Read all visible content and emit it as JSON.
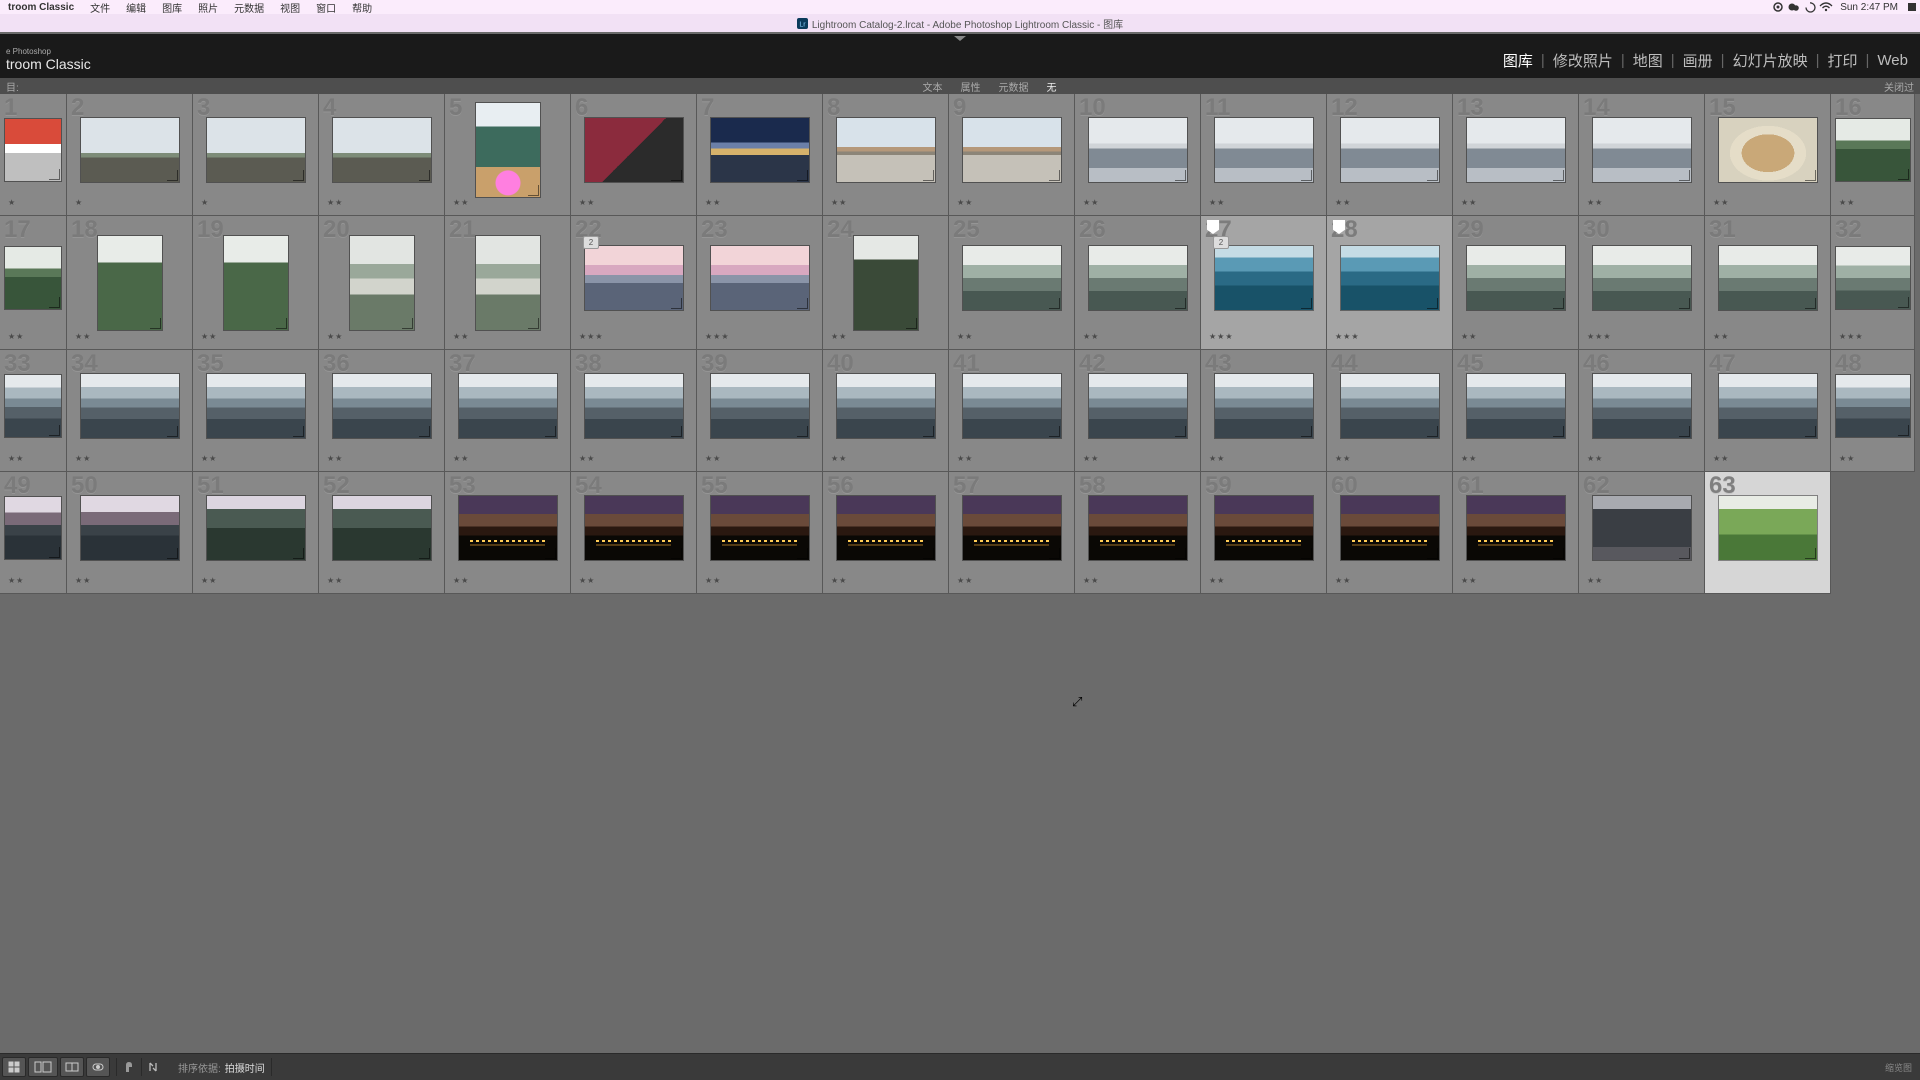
{
  "mac_menu": {
    "app": "troom Classic",
    "items": [
      "文件",
      "编辑",
      "图库",
      "照片",
      "元数据",
      "视图",
      "窗口",
      "帮助"
    ],
    "clock": "Sun 2:47 PM"
  },
  "window_title": "Lightroom Catalog-2.lrcat - Adobe Photoshop Lightroom Classic - 图库",
  "logo": {
    "small": "e Photoshop",
    "big": "troom Classic"
  },
  "modules": [
    "图库",
    "修改照片",
    "地图",
    "画册",
    "幻灯片放映",
    "打印",
    "Web"
  ],
  "modules_active": 0,
  "info_bar": {
    "left": "目:",
    "options": [
      "文本",
      "属性",
      "元数据",
      "无"
    ],
    "active": 3,
    "right": "关闭过"
  },
  "toolbar": {
    "sort_label": "排序依据:",
    "sort_value": "拍摄时间",
    "right": "缩览图"
  },
  "thumbs": [
    {
      "n": 1,
      "s": 1,
      "o": "l",
      "t": "t-red",
      "first": true
    },
    {
      "n": 2,
      "s": 1,
      "o": "l",
      "t": "t-road"
    },
    {
      "n": 3,
      "s": 1,
      "o": "l",
      "t": "t-road"
    },
    {
      "n": 4,
      "s": 2,
      "o": "l",
      "t": "t-road"
    },
    {
      "n": 5,
      "s": 2,
      "o": "p",
      "t": "t-temple1"
    },
    {
      "n": 6,
      "s": 2,
      "o": "l",
      "t": "t-temple2"
    },
    {
      "n": 7,
      "s": 2,
      "o": "l",
      "t": "t-temple3"
    },
    {
      "n": 8,
      "s": 2,
      "o": "l",
      "t": "t-gate"
    },
    {
      "n": 9,
      "s": 2,
      "o": "l",
      "t": "t-gate"
    },
    {
      "n": 10,
      "s": 2,
      "o": "l",
      "t": "t-group"
    },
    {
      "n": 11,
      "s": 2,
      "o": "l",
      "t": "t-group"
    },
    {
      "n": 12,
      "s": 2,
      "o": "l",
      "t": "t-group"
    },
    {
      "n": 13,
      "s": 2,
      "o": "l",
      "t": "t-group"
    },
    {
      "n": 14,
      "s": 2,
      "o": "l",
      "t": "t-group"
    },
    {
      "n": 15,
      "s": 2,
      "o": "l",
      "t": "t-dog"
    },
    {
      "n": 16,
      "s": 2,
      "o": "l",
      "t": "t-green",
      "last": true
    },
    {
      "n": 17,
      "s": 2,
      "o": "l",
      "t": "t-green",
      "first": true,
      "tall": true
    },
    {
      "n": 18,
      "s": 2,
      "o": "p",
      "t": "t-treegreen",
      "tall": true
    },
    {
      "n": 19,
      "s": 2,
      "o": "p",
      "t": "t-treegreen",
      "tall": true
    },
    {
      "n": 20,
      "s": 2,
      "o": "p",
      "t": "t-path",
      "tall": true
    },
    {
      "n": 21,
      "s": 2,
      "o": "p",
      "t": "t-path",
      "tall": true
    },
    {
      "n": 22,
      "s": 3,
      "o": "l",
      "t": "t-sunset",
      "tall": true,
      "stack": 2
    },
    {
      "n": 23,
      "s": 3,
      "o": "l",
      "t": "t-sunset",
      "tall": true
    },
    {
      "n": 24,
      "s": 2,
      "o": "p",
      "t": "t-tree-dark",
      "tall": true
    },
    {
      "n": 25,
      "s": 2,
      "o": "l",
      "t": "t-haze",
      "tall": true
    },
    {
      "n": 26,
      "s": 2,
      "o": "l",
      "t": "t-haze",
      "tall": true
    },
    {
      "n": 27,
      "s": 3,
      "o": "l",
      "t": "t-bluemt",
      "tall": true,
      "pick": true,
      "stack": 2,
      "picked": true
    },
    {
      "n": 28,
      "s": 3,
      "o": "l",
      "t": "t-bluemt",
      "tall": true,
      "pick": true,
      "picked": true
    },
    {
      "n": 29,
      "s": 2,
      "o": "l",
      "t": "t-haze",
      "tall": true
    },
    {
      "n": 30,
      "s": 3,
      "o": "l",
      "t": "t-haze",
      "tall": true
    },
    {
      "n": 31,
      "s": 2,
      "o": "l",
      "t": "t-haze",
      "tall": true
    },
    {
      "n": 32,
      "s": 3,
      "o": "l",
      "t": "t-haze",
      "last": true,
      "tall": true
    },
    {
      "n": 33,
      "s": 2,
      "o": "l",
      "t": "t-mtlayer",
      "first": true
    },
    {
      "n": 34,
      "s": 2,
      "o": "l",
      "t": "t-mtlayer"
    },
    {
      "n": 35,
      "s": 2,
      "o": "l",
      "t": "t-mtlayer"
    },
    {
      "n": 36,
      "s": 2,
      "o": "l",
      "t": "t-mtlayer"
    },
    {
      "n": 37,
      "s": 2,
      "o": "l",
      "t": "t-mtlayer"
    },
    {
      "n": 38,
      "s": 2,
      "o": "l",
      "t": "t-mtlayer"
    },
    {
      "n": 39,
      "s": 2,
      "o": "l",
      "t": "t-mtlayer"
    },
    {
      "n": 40,
      "s": 2,
      "o": "l",
      "t": "t-mtlayer"
    },
    {
      "n": 41,
      "s": 2,
      "o": "l",
      "t": "t-mtlayer"
    },
    {
      "n": 42,
      "s": 2,
      "o": "l",
      "t": "t-mtlayer"
    },
    {
      "n": 43,
      "s": 2,
      "o": "l",
      "t": "t-mtlayer"
    },
    {
      "n": 44,
      "s": 2,
      "o": "l",
      "t": "t-mtlayer"
    },
    {
      "n": 45,
      "s": 2,
      "o": "l",
      "t": "t-mtlayer"
    },
    {
      "n": 46,
      "s": 2,
      "o": "l",
      "t": "t-mtlayer"
    },
    {
      "n": 47,
      "s": 2,
      "o": "l",
      "t": "t-mtlayer"
    },
    {
      "n": 48,
      "s": 2,
      "o": "l",
      "t": "t-mtlayer",
      "last": true
    },
    {
      "n": 49,
      "s": 2,
      "o": "l",
      "t": "t-dusk",
      "first": true
    },
    {
      "n": 50,
      "s": 2,
      "o": "l",
      "t": "t-dusk"
    },
    {
      "n": 51,
      "s": 2,
      "o": "l",
      "t": "t-dusktree"
    },
    {
      "n": 52,
      "s": 2,
      "o": "l",
      "t": "t-dusktree"
    },
    {
      "n": 53,
      "s": 2,
      "o": "l",
      "t": "t-night"
    },
    {
      "n": 54,
      "s": 2,
      "o": "l",
      "t": "t-night"
    },
    {
      "n": 55,
      "s": 2,
      "o": "l",
      "t": "t-night"
    },
    {
      "n": 56,
      "s": 2,
      "o": "l",
      "t": "t-night"
    },
    {
      "n": 57,
      "s": 2,
      "o": "l",
      "t": "t-night"
    },
    {
      "n": 58,
      "s": 2,
      "o": "l",
      "t": "t-night"
    },
    {
      "n": 59,
      "s": 2,
      "o": "l",
      "t": "t-night"
    },
    {
      "n": 60,
      "s": 2,
      "o": "l",
      "t": "t-night"
    },
    {
      "n": 61,
      "s": 2,
      "o": "l",
      "t": "t-night"
    },
    {
      "n": 62,
      "s": 2,
      "o": "l",
      "t": "t-group-dark"
    },
    {
      "n": 63,
      "s": 0,
      "o": "l",
      "t": "t-greenman",
      "selected": true
    }
  ]
}
